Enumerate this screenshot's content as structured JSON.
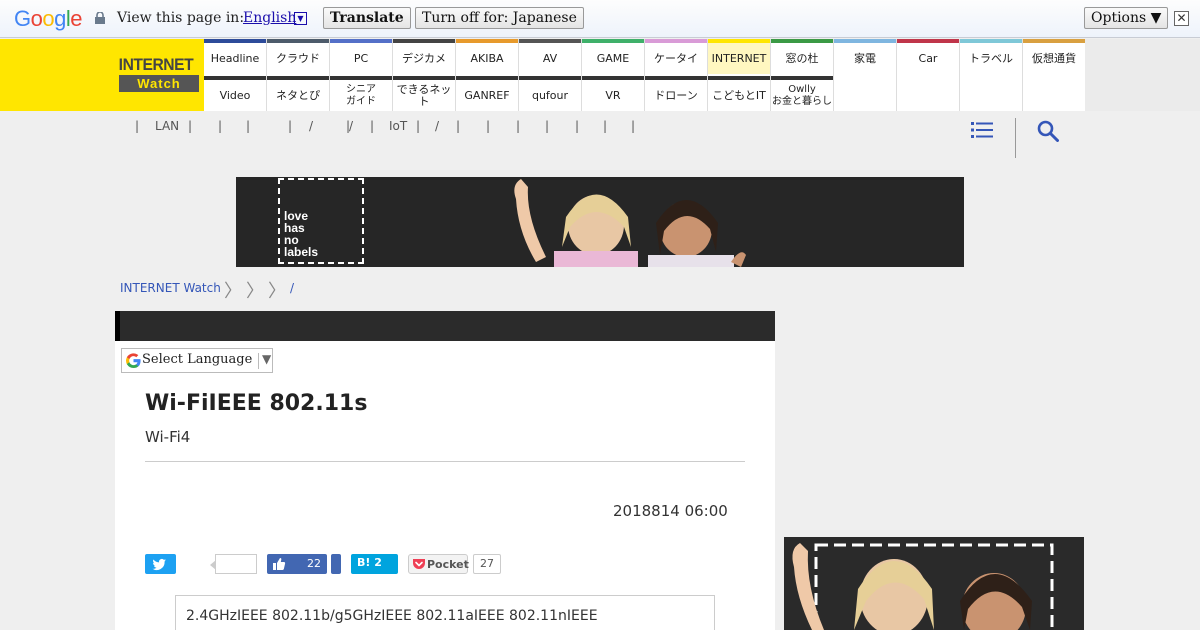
{
  "translate_bar": {
    "logo_letters": [
      "G",
      "o",
      "o",
      "g",
      "l",
      "e"
    ],
    "view_label": "View this page in:",
    "language": "English",
    "translate_button": "Translate",
    "turn_off_button": "Turn off for: Japanese",
    "options_button": "Options ▼",
    "close_glyph": "✕"
  },
  "site": {
    "logo_top": "INTERNET",
    "logo_bottom": "Watch"
  },
  "nav": {
    "row1": [
      {
        "label": "Headline",
        "color": "#2d4b9a"
      },
      {
        "label": "クラウド",
        "color": "#4d5b6b"
      },
      {
        "label": "PC",
        "color": "#5470c8"
      },
      {
        "label": "デジカメ",
        "color": "#444444"
      },
      {
        "label": "AKIBA",
        "color": "#e79a2c"
      },
      {
        "label": "AV",
        "color": "#555555"
      },
      {
        "label": "GAME",
        "color": "#3fb06a"
      },
      {
        "label": "ケータイ",
        "color": "#d99bd7"
      },
      {
        "label": "INTERNET",
        "color": "#ffe600",
        "active": true
      },
      {
        "label": "窓の杜",
        "color": "#3b9a45"
      },
      {
        "label": "家電",
        "color": "#7fb6e0"
      },
      {
        "label": "Car",
        "color": "#c0354a"
      },
      {
        "label": "トラベル",
        "color": "#7fc8d8"
      },
      {
        "label": "仮想通貨",
        "color": "#d9a040"
      }
    ],
    "row2": [
      {
        "label": "Video"
      },
      {
        "label": "ネタとぴ"
      },
      {
        "label": "シニア\nガイド"
      },
      {
        "label": "できるネット"
      },
      {
        "label": "GANREF"
      },
      {
        "label": "qufour"
      },
      {
        "label": "VR"
      },
      {
        "label": "ドローン"
      },
      {
        "label": "こどもとIT"
      },
      {
        "label": "Owlly\nお金と暮らし"
      }
    ]
  },
  "subnav": {
    "items": [
      "|",
      "LAN",
      "|",
      "|",
      "|",
      "|",
      "/",
      "|",
      "/",
      "|",
      "IoT",
      "|",
      "/",
      "|",
      "|",
      "|",
      "|",
      "|",
      "|",
      "|"
    ]
  },
  "banner_ad": {
    "text_lines": [
      "love",
      "has",
      "no",
      "labels"
    ]
  },
  "breadcrumb": {
    "root": "INTERNET Watch",
    "sep": "〉",
    "tail": "/"
  },
  "article": {
    "language_select": "Select Language",
    "language_arrow": "▼",
    "headline": "Wi-FiIEEE 802.11s",
    "subhead": "Wi-Fi4",
    "date": "2018814 06:00",
    "facebook_count": "22",
    "hatena_label": "B! 2",
    "pocket_label": "Pocket",
    "pocket_count": "27",
    "spec_text": "2.4GHzIEEE 802.11b/g5GHzIEEE 802.11aIEEE 802.11nIEEE"
  }
}
